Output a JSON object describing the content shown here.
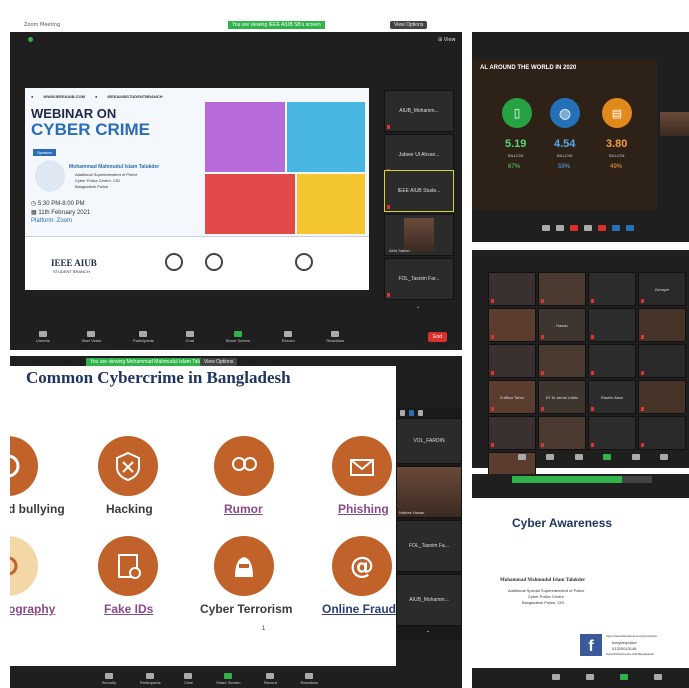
{
  "q1": {
    "banner": "You are viewing IEEE AIUB SB's screen",
    "view_options": "View Options",
    "exit_label": "Exit",
    "poster": {
      "website": "WWW.IEEEAIUB.COM",
      "facebook": "IEEEAIUBSTUDENTBRANCH",
      "title_line1": "WEBINAR ON",
      "title_line2": "CYBER CRIME",
      "speaker_tag": "Speaker",
      "speaker_name": "Mohammad Mahmudul Islam Talukder",
      "speaker_role1": "Additional Superintendent of Police",
      "speaker_role2": "Cyber Police Centre, CID",
      "speaker_role3": "Bangladesh Police",
      "time": "5:30 PM-8:00 PM",
      "date": "11th February 2021",
      "platform": "Platform: Zoom",
      "org_line1": "IEEE AIUB",
      "org_line2": "STUDENT BRANCH"
    },
    "participants": [
      "AIUB_Mohamm...",
      "Jabeer Ul Ahsan...",
      "IEEE AIUB Stude...",
      "Abid Sarker",
      "FOL_Tasnim Far..."
    ],
    "toolbar": [
      "Unmute",
      "Start Video",
      "Participants",
      "Chat",
      "Share Screen",
      "Record",
      "Reactions"
    ],
    "end_label": "End"
  },
  "q2": {
    "slide_title": "AL AROUND THE WORLD IN 2020",
    "stats": [
      {
        "value": "5.19",
        "sub1": "BILLION",
        "sub2": "67%",
        "color": "#27a243"
      },
      {
        "value": "4.54",
        "sub1": "BILLION",
        "sub2": "59%",
        "color": "#2471b8"
      },
      {
        "value": "3.80",
        "sub1": "BILLION",
        "sub2": "49%",
        "color": "#e08a1e"
      }
    ]
  },
  "q3": {
    "names": [
      "",
      "",
      "",
      "Zuhayer",
      "",
      "Hasan",
      "",
      "",
      "",
      "",
      "",
      "",
      "Zulfikar Taher",
      "AT M Jamal Uddin",
      "Rashik Alam",
      "",
      "",
      "",
      "",
      "",
      ""
    ]
  },
  "q4": {
    "banner": "You are viewing Mohammad Mahmudul Islam Talukder's screen",
    "view_options": "View Options",
    "slide_title": "Common Cybercrime in Bangladesh",
    "items": [
      {
        "label": "d bullying"
      },
      {
        "label": "Hacking"
      },
      {
        "label": "Rumor"
      },
      {
        "label": "Phishing"
      },
      {
        "label": "ography"
      },
      {
        "label": "Fake IDs"
      },
      {
        "label": "Cyber Terrorism"
      },
      {
        "label": "Online Fraud"
      }
    ],
    "slide_number": "1",
    "sidebar": [
      "VOL_FARDIN",
      "Nafees Hasan",
      "FOL_Tasnim Fa...",
      "AIUB_Mohamm..."
    ],
    "toolbar": [
      "Security",
      "Participants",
      "Chat",
      "Share Screen",
      "Record",
      "Reactions"
    ]
  },
  "q5": {
    "title": "Cyber Awareness",
    "name": "Mohammad Mahmudul Islam Talukder",
    "role1": "Additional Special Superintendent of Police",
    "role2": "Cyber Police Centre",
    "role3": "Bangladesh Police, CID",
    "fb_text1": "https://www.facebook.com/cyberpolice",
    "fb_text2": "bdcyberpolice",
    "fb_text3": "01320010148",
    "fb_text4": "CyberPoliceCentre.CID.Bangladesh"
  }
}
